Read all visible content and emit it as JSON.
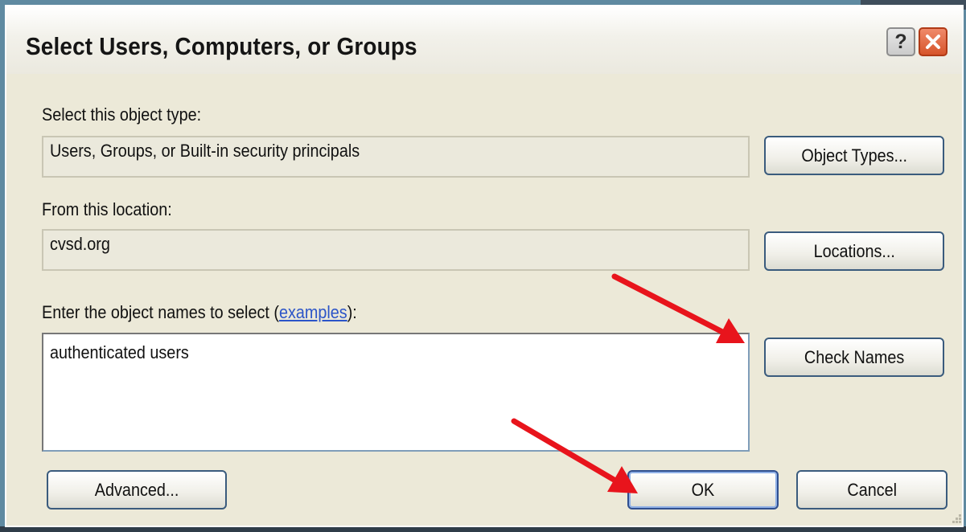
{
  "window": {
    "title": "Select Users, Computers, or Groups",
    "help_glyph": "?",
    "close_icon": "close-x-icon"
  },
  "object_type": {
    "label": "Select this object type:",
    "value": "Users, Groups, or Built-in security principals",
    "button": "Object Types..."
  },
  "location": {
    "label": "From this location:",
    "value": "cvsd.org",
    "button": "Locations..."
  },
  "names": {
    "label_prefix": "Enter the object names to select (",
    "label_link": "examples",
    "label_suffix": "):",
    "value": "authenticated users",
    "check_button": "Check Names"
  },
  "footer": {
    "advanced_button": "Advanced...",
    "ok_button": "OK",
    "cancel_button": "Cancel"
  },
  "colors": {
    "background": "#5f8aa1",
    "dialog": "#ece9d8",
    "annotation_arrow": "#e8141c",
    "link": "#2c55c8"
  }
}
